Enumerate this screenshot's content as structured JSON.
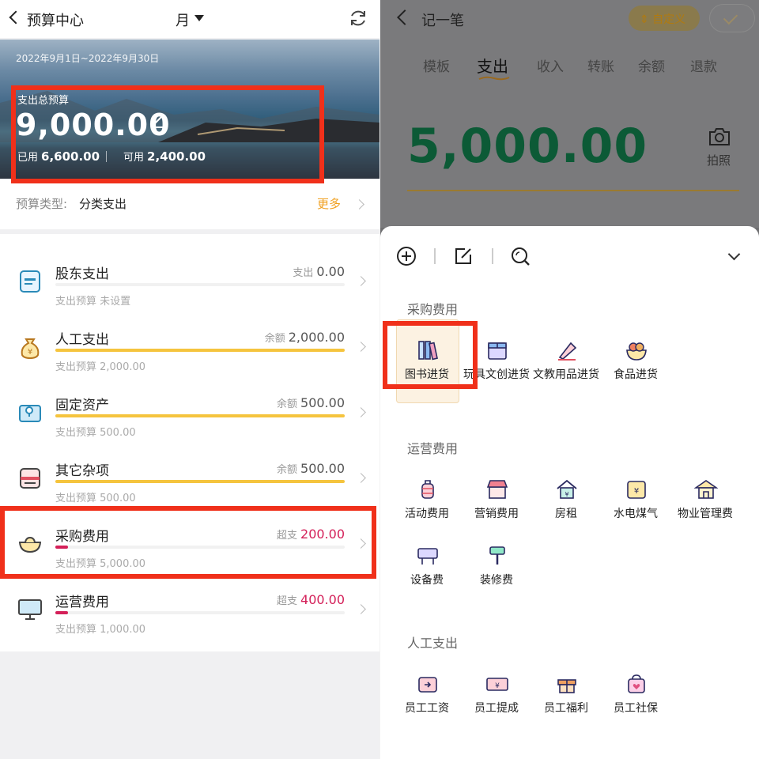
{
  "left": {
    "header": {
      "title": "预算中心",
      "period": "月"
    },
    "hero": {
      "date_range": "2022年9月1日~2022年9月30日",
      "total_label": "支出总预算",
      "total_amount": "9,000.00",
      "used_label": "已用",
      "used_value": "6,600.00",
      "available_label": "可用",
      "available_value": "2,400.00"
    },
    "budget_type": {
      "label": "预算类型:",
      "value": "分类支出",
      "more": "更多"
    },
    "items": [
      {
        "name": "股东支出",
        "right_label": "支出",
        "right_value": "0.00",
        "sub": "支出预算 未设置",
        "progress": 0,
        "overspent": false
      },
      {
        "name": "人工支出",
        "right_label": "余额",
        "right_value": "2,000.00",
        "sub": "支出预算 2,000.00",
        "progress": 1,
        "overspent": false
      },
      {
        "name": "固定资产",
        "right_label": "余额",
        "right_value": "500.00",
        "sub": "支出预算 500.00",
        "progress": 1,
        "overspent": false
      },
      {
        "name": "其它杂项",
        "right_label": "余额",
        "right_value": "500.00",
        "sub": "支出预算 500.00",
        "progress": 1,
        "overspent": false
      },
      {
        "name": "采购费用",
        "right_label": "超支",
        "right_value": "200.00",
        "sub": "支出预算 5,000.00",
        "progress": 1.04,
        "overspent": true
      },
      {
        "name": "运营费用",
        "right_label": "超支",
        "right_value": "400.00",
        "sub": "支出预算 1,000.00",
        "progress": 1.4,
        "overspent": true
      }
    ]
  },
  "right": {
    "header": {
      "title": "记一笔",
      "custom_label": "自定义"
    },
    "tabs": [
      "模板",
      "支出",
      "收入",
      "转账",
      "余额",
      "退款"
    ],
    "active_tab": "支出",
    "amount": "5,000.00",
    "camera_label": "拍照",
    "sections": [
      {
        "title": "采购费用",
        "items": [
          "图书进货",
          "玩具文创进货",
          "文教用品进货",
          "食品进货"
        ]
      },
      {
        "title": "运营费用",
        "items": [
          "活动费用",
          "营销费用",
          "房租",
          "水电煤气",
          "物业管理费",
          "设备费",
          "装修费"
        ]
      },
      {
        "title": "人工支出",
        "items": [
          "员工工资",
          "员工提成",
          "员工福利",
          "员工社保"
        ]
      }
    ],
    "selected_item": "图书进货"
  },
  "colors": {
    "accent": "#f0a020",
    "overspend": "#d42059",
    "highlight": "#f0301a",
    "amount": "#0c5a36"
  }
}
